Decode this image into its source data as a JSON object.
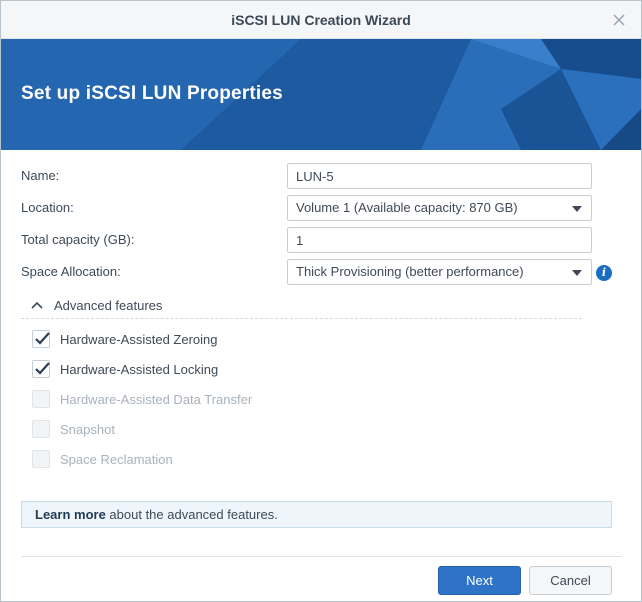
{
  "window": {
    "title": "iSCSI LUN Creation Wizard",
    "close_icon": "close-icon"
  },
  "banner": {
    "heading": "Set up iSCSI LUN Properties",
    "colors": {
      "base": "#1f5fa8",
      "light": "#2d72bf",
      "dark": "#174d8c"
    }
  },
  "form": {
    "name": {
      "label": "Name:",
      "value": "LUN-5"
    },
    "location": {
      "label": "Location:",
      "value": "Volume 1 (Available capacity: 870 GB)"
    },
    "capacity": {
      "label": "Total capacity (GB):",
      "value": "1"
    },
    "allocation": {
      "label": "Space Allocation:",
      "value": "Thick Provisioning (better performance)",
      "info_icon": "info-icon"
    }
  },
  "advanced": {
    "toggle_label": "Advanced features",
    "options": [
      {
        "label": "Hardware-Assisted Zeroing",
        "checked": true,
        "disabled": false
      },
      {
        "label": "Hardware-Assisted Locking",
        "checked": true,
        "disabled": false
      },
      {
        "label": "Hardware-Assisted Data Transfer",
        "checked": false,
        "disabled": true
      },
      {
        "label": "Snapshot",
        "checked": false,
        "disabled": true
      },
      {
        "label": "Space Reclamation",
        "checked": false,
        "disabled": true
      }
    ]
  },
  "learn_more": {
    "link": "Learn more",
    "text": " about the advanced features."
  },
  "buttons": {
    "next": "Next",
    "cancel": "Cancel"
  },
  "colors": {
    "accent": "#2f73c6",
    "checkmark": "#2b3f55",
    "disabled_text": "#a9b2bb"
  }
}
